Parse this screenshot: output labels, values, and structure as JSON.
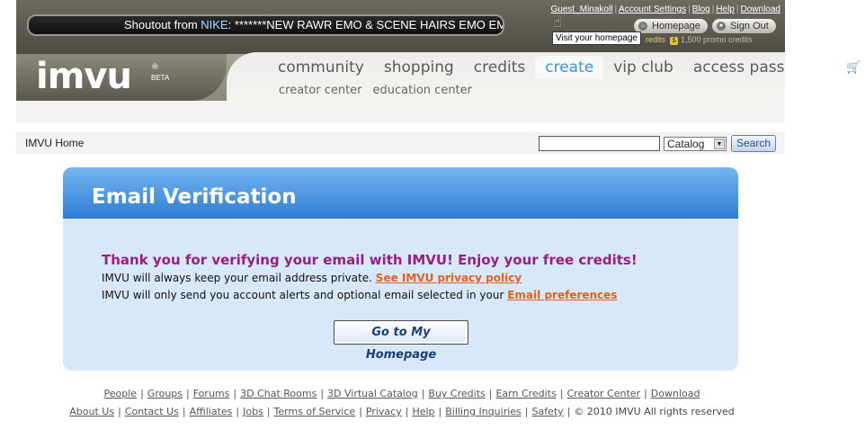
{
  "header": {
    "shoutout_prefix": "Shoutout from ",
    "shoutout_nick": "NIKE",
    "shoutout_text": ": *******NEW RAWR EMO & SCENE HAIRS EMO EMO \\",
    "user_link": "Guest_Minakoll",
    "top_links": [
      "Account Settings",
      "Blog",
      "Help",
      "Download"
    ],
    "homepage_label": "Homepage",
    "signout_label": "Sign Out",
    "credits_text": "redits",
    "promo_text": "1,500 promo credits",
    "tooltip": "Visit your homepage",
    "logo_text": "imvu",
    "logo_reg": "®",
    "logo_beta": "BETA",
    "nav": [
      "community",
      "shopping",
      "credits",
      "create",
      "vip club",
      "access pass"
    ],
    "active_nav": "create",
    "subnav": [
      "creator center",
      "education center"
    ]
  },
  "toolbar": {
    "breadcrumb": "IMVU Home",
    "search_value": "",
    "catalog_value": "Catalog",
    "search_label": "Search"
  },
  "panel": {
    "title": "Email Verification",
    "thanks": "Thank you for verifying your email with IMVU! Enjoy your free credits!",
    "line1_text": "IMVU will always keep your email address private. ",
    "line1_link": "See IMVU privacy policy",
    "line2_text": "IMVU will only send you account alerts and optional email selected in your ",
    "line2_link": "Email preferences",
    "button_label": "Go to My Homepage"
  },
  "footer": {
    "row1": [
      "People",
      "Groups",
      "Forums",
      "3D Chat Rooms",
      "3D Virtual Catalog",
      "Buy Credits",
      "Earn Credits",
      "Creator Center",
      "Download"
    ],
    "row2": [
      "About Us",
      "Contact Us",
      "Affiliates",
      "Jobs",
      "Terms of Service",
      "Privacy",
      "Help",
      "Billing Inquiries",
      "Safety"
    ],
    "copyright": "© 2010 IMVU All rights reserved"
  },
  "colors": {
    "accent_blue": "#2f7ed5",
    "thanks_purple": "#9b1e7f",
    "link_orange": "#e2621b"
  }
}
